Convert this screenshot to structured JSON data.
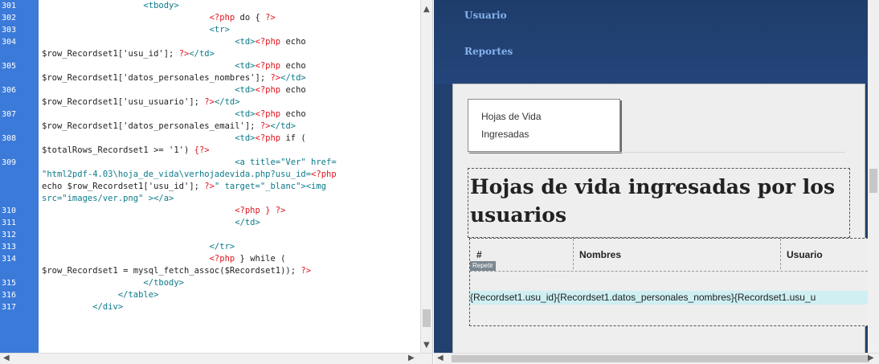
{
  "code_editor": {
    "lines": [
      {
        "n": "301",
        "parts": [
          {
            "t": "tag",
            "v": "                    <tbody>"
          }
        ]
      },
      {
        "n": "302",
        "parts": [
          {
            "t": "php",
            "v": "                                 <?php "
          },
          {
            "t": "plain",
            "v": "do { "
          },
          {
            "t": "php",
            "v": "?>"
          }
        ]
      },
      {
        "n": "303",
        "parts": [
          {
            "t": "tag",
            "v": "                                 <tr>"
          }
        ]
      },
      {
        "n": "304",
        "parts": [
          {
            "t": "tag",
            "v": "                                      <td>"
          },
          {
            "t": "php",
            "v": "<?php "
          },
          {
            "t": "plain",
            "v": "echo"
          }
        ]
      },
      {
        "n": "",
        "parts": [
          {
            "t": "plain",
            "v": "$row_Recordset1['usu_id']; "
          },
          {
            "t": "php",
            "v": "?>"
          },
          {
            "t": "tag",
            "v": "</td>"
          }
        ]
      },
      {
        "n": "305",
        "parts": [
          {
            "t": "tag",
            "v": "                                      <td>"
          },
          {
            "t": "php",
            "v": "<?php "
          },
          {
            "t": "plain",
            "v": "echo"
          }
        ]
      },
      {
        "n": "",
        "parts": [
          {
            "t": "plain",
            "v": "$row_Recordset1['datos_personales_nombres']; "
          },
          {
            "t": "php",
            "v": "?>"
          },
          {
            "t": "tag",
            "v": "</td>"
          }
        ]
      },
      {
        "n": "306",
        "parts": [
          {
            "t": "tag",
            "v": "                                      <td>"
          },
          {
            "t": "php",
            "v": "<?php "
          },
          {
            "t": "plain",
            "v": "echo"
          }
        ]
      },
      {
        "n": "",
        "parts": [
          {
            "t": "plain",
            "v": "$row_Recordset1['usu_usuario']; "
          },
          {
            "t": "php",
            "v": "?>"
          },
          {
            "t": "tag",
            "v": "</td>"
          }
        ]
      },
      {
        "n": "307",
        "parts": [
          {
            "t": "tag",
            "v": "                                      <td>"
          },
          {
            "t": "php",
            "v": "<?php "
          },
          {
            "t": "plain",
            "v": "echo"
          }
        ]
      },
      {
        "n": "",
        "parts": [
          {
            "t": "plain",
            "v": "$row_Recordset1['datos_personales_email']; "
          },
          {
            "t": "php",
            "v": "?>"
          },
          {
            "t": "tag",
            "v": "</td>"
          }
        ]
      },
      {
        "n": "308",
        "parts": [
          {
            "t": "tag",
            "v": "                                      <td>"
          },
          {
            "t": "php",
            "v": "<?php "
          },
          {
            "t": "plain",
            "v": "if ("
          }
        ]
      },
      {
        "n": "",
        "parts": [
          {
            "t": "plain",
            "v": "$totalRows_Recordset1 >= '1') "
          },
          {
            "t": "php",
            "v": "{?>"
          }
        ]
      },
      {
        "n": "309",
        "parts": [
          {
            "t": "tag",
            "v": "                                      <a title=\"Ver\" href="
          }
        ]
      },
      {
        "n": "",
        "parts": [
          {
            "t": "str",
            "v": "\"html2pdf-4.03\\hoja_de_vida\\verhojadevida.php?usu_id="
          },
          {
            "t": "php",
            "v": "<?php"
          }
        ]
      },
      {
        "n": "",
        "parts": [
          {
            "t": "plain",
            "v": "echo $row_Recordset1['usu_id']; "
          },
          {
            "t": "php",
            "v": "?>"
          },
          {
            "t": "str",
            "v": "\" target=\"_blanc\"><img"
          }
        ]
      },
      {
        "n": "",
        "parts": [
          {
            "t": "str",
            "v": "src=\"images/ver.png\" ></a>"
          }
        ]
      },
      {
        "n": "310",
        "parts": [
          {
            "t": "php",
            "v": "                                      <?php } ?>"
          }
        ]
      },
      {
        "n": "311",
        "parts": [
          {
            "t": "tag",
            "v": "                                      </td>"
          }
        ]
      },
      {
        "n": "312",
        "parts": [
          {
            "t": "plain",
            "v": ""
          }
        ]
      },
      {
        "n": "313",
        "parts": [
          {
            "t": "tag",
            "v": "                                 </tr>"
          }
        ]
      },
      {
        "n": "314",
        "parts": [
          {
            "t": "php",
            "v": "                                 <?php "
          },
          {
            "t": "plain",
            "v": "} while ("
          }
        ]
      },
      {
        "n": "",
        "parts": [
          {
            "t": "plain",
            "v": "$row_Recordset1 = mysql_fetch_assoc($Recordset1)); "
          },
          {
            "t": "php",
            "v": "?>"
          }
        ]
      },
      {
        "n": "315",
        "parts": [
          {
            "t": "tag",
            "v": "                    </tbody>"
          }
        ]
      },
      {
        "n": "316",
        "parts": [
          {
            "t": "tag",
            "v": "               </table>"
          }
        ]
      },
      {
        "n": "317",
        "parts": [
          {
            "t": "tag",
            "v": "          </div>"
          }
        ]
      }
    ]
  },
  "design_view": {
    "nav": {
      "item1": "Usuario",
      "item2": "Reportes"
    },
    "tab_card": {
      "line1": "Hojas de Vida",
      "line2": "Ingresadas"
    },
    "heading": "Hojas de vida ingresadas por los usuarios",
    "table": {
      "headers": [
        "#",
        "Nombres",
        "Usuario"
      ],
      "repeat_badge": "Repetir",
      "row": "{Recordset1.usu_id}{Recordset1.datos_personales_nombres}{Recordset1.usu_u"
    }
  },
  "icons": [
    "scroll-up-arrow-icon",
    "scroll-down-arrow-icon",
    "scroll-left-arrow-icon",
    "scroll-right-arrow-icon"
  ]
}
